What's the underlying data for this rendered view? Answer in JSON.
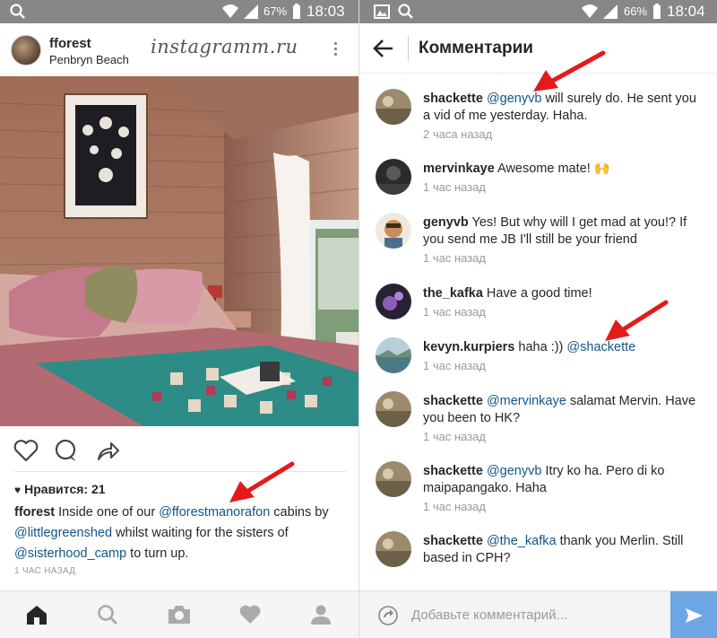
{
  "left": {
    "status": {
      "battery": "67%",
      "time": "18:03"
    },
    "post": {
      "username": "fforest",
      "location": "Penbryn Beach",
      "watermark": "instagramm.ru",
      "likes": "Нравится: 21",
      "caption": {
        "user": "fforest",
        "t1": " Inside one of our ",
        "m1": "@fforestmanorafon",
        "t2": " cabins by ",
        "m2": "@littlegreenshed",
        "t3": " whilst waiting for the sisters of ",
        "m3": "@sisterhood_camp",
        "t4": " to turn up."
      },
      "time": "1 ЧАС НАЗАД"
    },
    "nav": [
      "home-icon",
      "search-icon",
      "camera-icon",
      "heart-icon",
      "profile-icon"
    ]
  },
  "right": {
    "status": {
      "battery": "66%",
      "time": "18:04"
    },
    "title": "Комментарии",
    "comments": [
      {
        "user": "shackette",
        "mention": "@genyvb",
        "text": " will surely do. He sent you a vid of me yesterday. Haha.",
        "time": "2 часа назад"
      },
      {
        "user": "mervinkaye",
        "mention": "",
        "text": " Awesome mate! 🙌",
        "time": "1 час назад"
      },
      {
        "user": "genyvb",
        "mention": "",
        "text": " Yes! But why will I get mad at you!? If you send me JB I'll still be your friend",
        "time": "1 час назад"
      },
      {
        "user": "the_kafka",
        "mention": "",
        "text": " Have a good time!",
        "time": "1 час назад"
      },
      {
        "user": "kevyn.kurpiers",
        "mention": "",
        "text": " haha :)) ",
        "mention_after": "@shackette",
        "time": "1 час назад"
      },
      {
        "user": "shackette",
        "mention": "@mervinkaye",
        "text": " salamat Mervin. Have you been to HK?",
        "time": "1 час назад"
      },
      {
        "user": "shackette",
        "mention": "@genyvb",
        "text": " Itry ko ha. Pero di ko maipapangako. Haha",
        "time": "1 час назад"
      },
      {
        "user": "shackette",
        "mention": "@the_kafka",
        "text": " thank you Merlin. Still based in CPH?",
        "time": "1 час назад"
      }
    ],
    "input_placeholder": "Добавьте комментарий..."
  },
  "colors": {
    "mention": "#125688",
    "arrow": "#e31b1b",
    "send": "#6ea6e3",
    "statusbar": "#878787"
  }
}
